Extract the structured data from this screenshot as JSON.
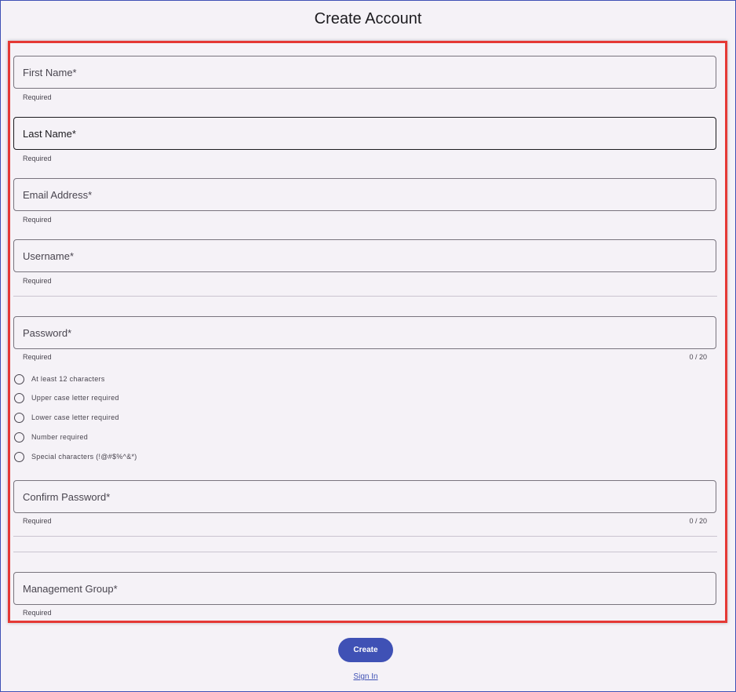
{
  "page": {
    "title": "Create Account"
  },
  "form": {
    "first_name": {
      "label": "First Name*",
      "hint": "Required"
    },
    "last_name": {
      "label": "Last Name*",
      "hint": "Required"
    },
    "email": {
      "label": "Email Address*",
      "hint": "Required"
    },
    "username": {
      "label": "Username*",
      "hint": "Required"
    },
    "password": {
      "label": "Password*",
      "hint": "Required",
      "counter": "0 / 20"
    },
    "password_rules": [
      "At least 12 characters",
      "Upper case letter required",
      "Lower case letter required",
      "Number required",
      "Special characters (!@#$%^&*)"
    ],
    "confirm_password": {
      "label": "Confirm Password*",
      "hint": "Required",
      "counter": "0 / 20"
    },
    "management_group": {
      "label": "Management Group*",
      "hint": "Required"
    }
  },
  "actions": {
    "create_label": "Create",
    "signin_label": "Sign In"
  },
  "colors": {
    "accent": "#3f51b5",
    "highlight_border": "#e53935",
    "background": "#f5f2f7"
  }
}
